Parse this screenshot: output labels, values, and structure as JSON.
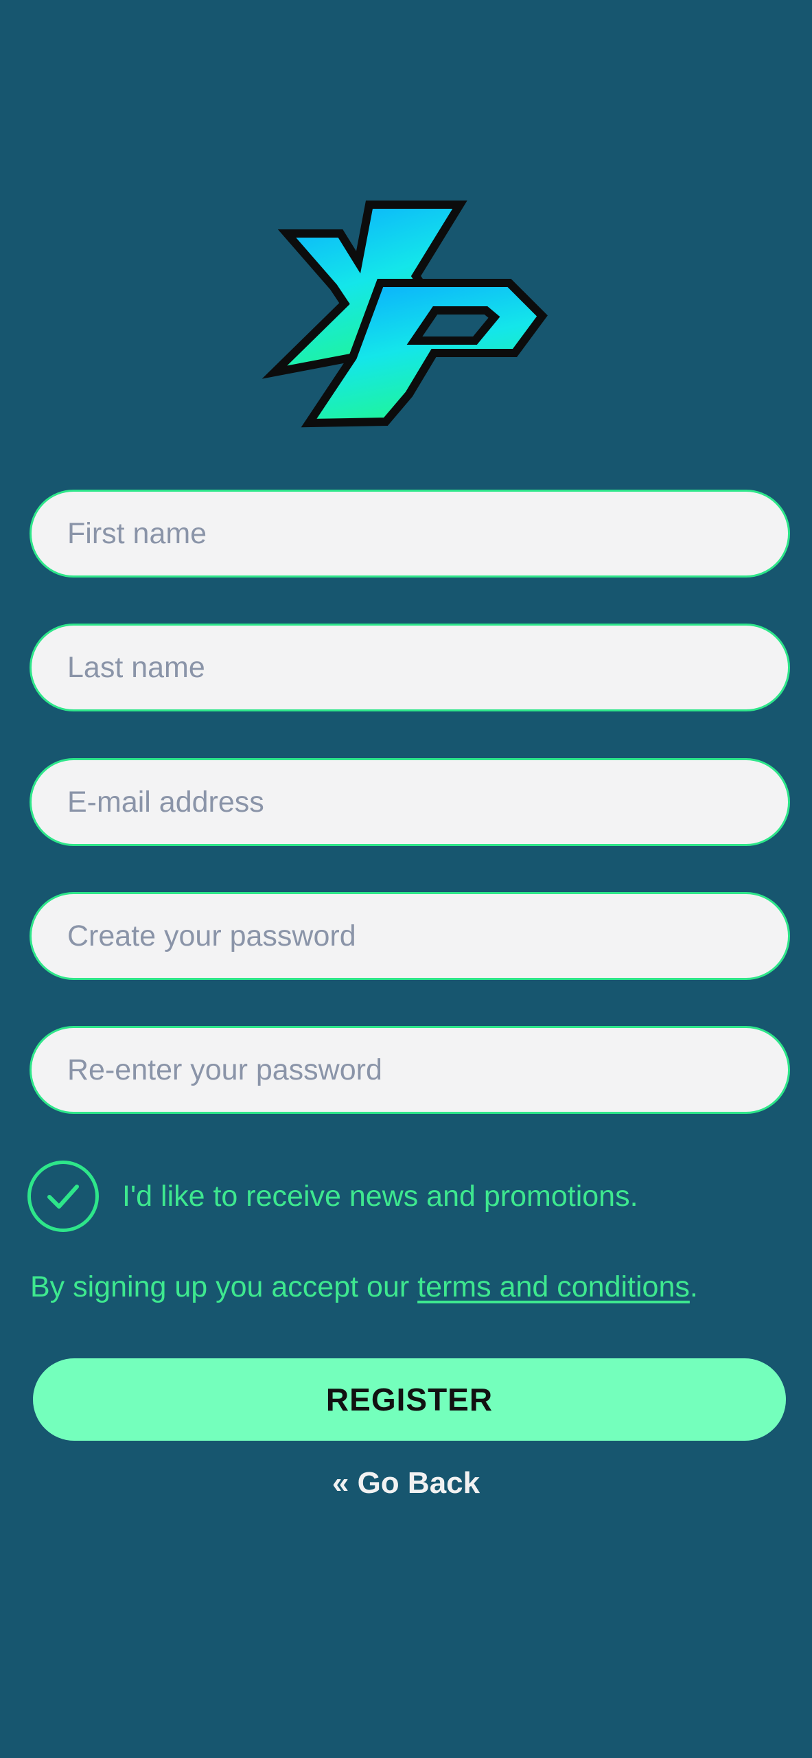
{
  "brand": {
    "logo_icon": "xp-logo-icon",
    "colors": {
      "background": "#17566f",
      "accent": "#2ee68a",
      "button": "#74ffbc"
    }
  },
  "form": {
    "first_name_placeholder": "First name",
    "last_name_placeholder": "Last name",
    "email_placeholder": "E-mail address",
    "password_placeholder": "Create your password",
    "confirm_password_placeholder": "Re-enter your password",
    "newsletter": {
      "label": "I'd like to receive news and promotions.",
      "checked": true,
      "icon": "checkmark-icon"
    },
    "terms": {
      "prefix": "By signing up you accept our ",
      "link_text": "terms and conditions",
      "suffix": "."
    },
    "register_label": "REGISTER",
    "go_back_label": "« Go Back"
  }
}
